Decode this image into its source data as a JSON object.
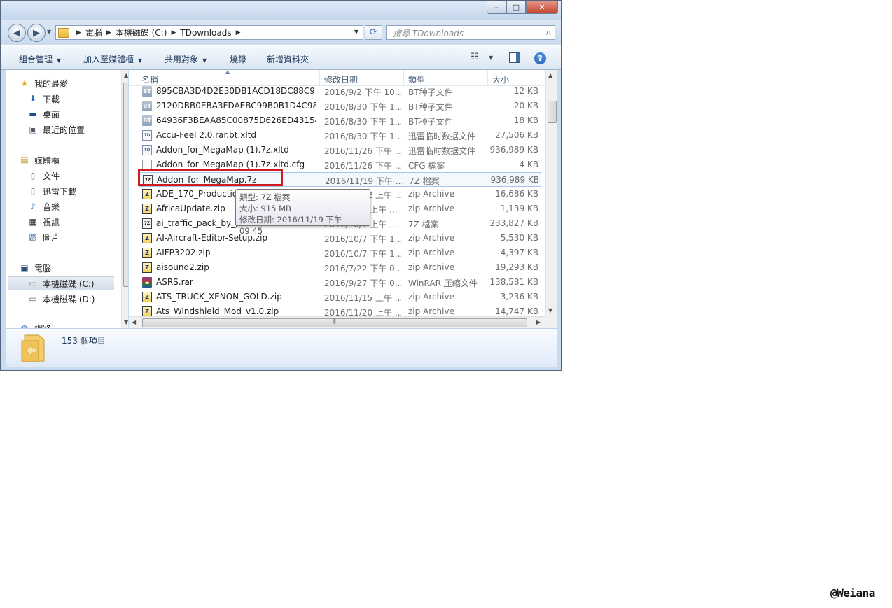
{
  "window": {
    "caption_buttons": {
      "minimize": "–",
      "maximize": "□",
      "close": "✕"
    }
  },
  "address": {
    "crumbs": [
      "電腦",
      "本機磁碟 (C:)",
      "TDownloads"
    ],
    "search_placeholder": "搜尋 TDownloads"
  },
  "toolbar": {
    "organize": "組合管理",
    "add_to_library": "加入至媒體櫃",
    "share_with": "共用對象",
    "burn": "燒錄",
    "new_folder": "新增資料夾"
  },
  "nav": {
    "favorites": "我的最愛",
    "downloads": "下載",
    "desktop": "桌面",
    "recent": "最近的位置",
    "libraries": "媒體櫃",
    "documents": "文件",
    "xunlei": "迅雷下載",
    "music": "音樂",
    "videos": "視訊",
    "pictures": "圖片",
    "computer": "電腦",
    "drive_c": "本機磁碟 (C:)",
    "drive_d": "本機磁碟 (D:)",
    "network": "網路"
  },
  "columns": {
    "name": "名稱",
    "modified": "修改日期",
    "type": "類型",
    "size": "大小"
  },
  "files": [
    {
      "name": "895CBA3D4D2E30DB1ACD18DC88C9...",
      "date": "2016/9/2 下午 10...",
      "type": "BT种子文件",
      "size": "12 KB",
      "icon": "BT"
    },
    {
      "name": "2120DBB0EBA3FDAEBC99B0B1D4C98...",
      "date": "2016/8/30 下午 1...",
      "type": "BT种子文件",
      "size": "20 KB",
      "icon": "BT"
    },
    {
      "name": "64936F3BEAA85C00875D626ED43154...",
      "date": "2016/8/30 下午 1...",
      "type": "BT种子文件",
      "size": "18 KB",
      "icon": "BT"
    },
    {
      "name": "Accu-Feel 2.0.rar.bt.xltd",
      "date": "2016/8/30 下午 1...",
      "type": "迅雷临时数据文件",
      "size": "27,506 KB",
      "icon": "TD"
    },
    {
      "name": "Addon_for_MegaMap (1).7z.xltd",
      "date": "2016/11/26 下午 ...",
      "type": "迅雷临时数据文件",
      "size": "936,989 KB",
      "icon": "TD"
    },
    {
      "name": "Addon_for_MegaMap (1).7z.xltd.cfg",
      "date": "2016/11/26 下午 ...",
      "type": "CFG 檔案",
      "size": "4 KB",
      "icon": "CFG"
    },
    {
      "name": "Addon_for_MegaMap.7z",
      "date": "2016/11/19 下午 ...",
      "type": "7Z 檔案",
      "size": "936,989 KB",
      "icon": "7Z"
    },
    {
      "name": "ADE_170_Production",
      "date": "2016/10/12 上午 ...",
      "type": "zip Archive",
      "size": "16,686 KB",
      "icon": "Z"
    },
    {
      "name": "AfricaUpdate.zip",
      "date": "2016/10/1 上午 ...",
      "type": "zip Archive",
      "size": "1,139 KB",
      "icon": "Z"
    },
    {
      "name": "ai_traffic_pack_by_Ja",
      "date": "2016/10/1 上午 ...",
      "type": "7Z 檔案",
      "size": "233,827 KB",
      "icon": "7Z"
    },
    {
      "name": "AI-Aircraft-Editor-Setup.zip",
      "date": "2016/10/7 下午 1...",
      "type": "zip Archive",
      "size": "5,530 KB",
      "icon": "Z"
    },
    {
      "name": "AIFP3202.zip",
      "date": "2016/10/7 下午 1...",
      "type": "zip Archive",
      "size": "4,397 KB",
      "icon": "Z"
    },
    {
      "name": "aisound2.zip",
      "date": "2016/7/22 下午 0...",
      "type": "zip Archive",
      "size": "19,293 KB",
      "icon": "Z"
    },
    {
      "name": "ASRS.rar",
      "date": "2016/9/27 下午 0...",
      "type": "WinRAR 压缩文件",
      "size": "138,581 KB",
      "icon": "R"
    },
    {
      "name": "ATS_TRUCK_XENON_GOLD.zip",
      "date": "2016/11/15 上午 ...",
      "type": "zip Archive",
      "size": "3,236 KB",
      "icon": "Z"
    },
    {
      "name": "Ats_Windshield_Mod_v1.0.zip",
      "date": "2016/11/20 上午 ...",
      "type": "zip Archive",
      "size": "14,747 KB",
      "icon": "Z"
    }
  ],
  "tooltip": {
    "type": "類型: 7Z 檔案",
    "size": "大小: 915 MB",
    "modified": "修改日期: 2016/11/19 下午 09:45"
  },
  "status": {
    "item_count": "153 個項目"
  },
  "watermark": "@Weiana",
  "colors": {
    "highlight_box": "#d11a1f",
    "selection": "#a5c5ea",
    "chrome": "#c9dbee"
  }
}
